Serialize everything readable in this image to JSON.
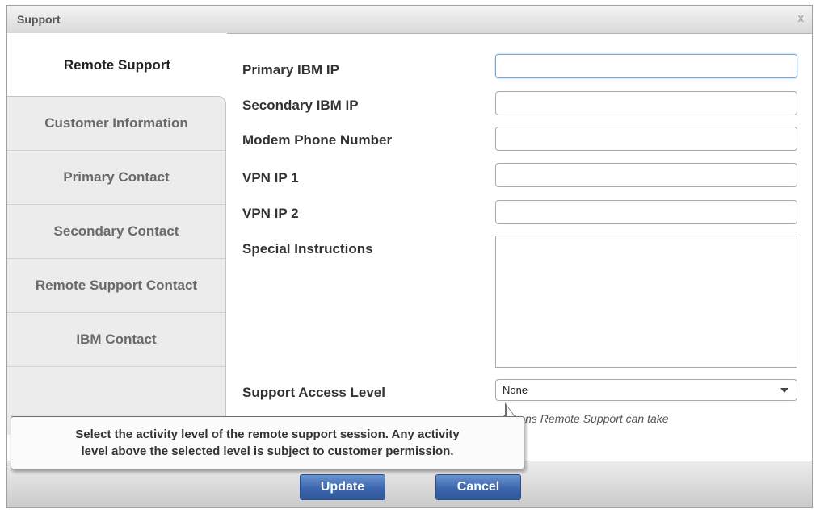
{
  "dialog": {
    "title": "Support",
    "close_label": "x"
  },
  "tabs": {
    "active": "Remote Support",
    "items": [
      {
        "label": "Customer Information"
      },
      {
        "label": "Primary Contact"
      },
      {
        "label": "Secondary Contact"
      },
      {
        "label": "Remote Support Contact"
      },
      {
        "label": "IBM Contact"
      }
    ]
  },
  "form": {
    "primary_ibm_ip": {
      "label": "Primary IBM IP",
      "value": ""
    },
    "secondary_ibm_ip": {
      "label": "Secondary IBM IP",
      "value": ""
    },
    "modem_phone_number": {
      "label": "Modem Phone Number",
      "value": ""
    },
    "vpn_ip_1": {
      "label": "VPN IP 1",
      "value": ""
    },
    "vpn_ip_2": {
      "label": "VPN IP 2",
      "value": ""
    },
    "special_instructions": {
      "label": "Special Instructions",
      "value": ""
    },
    "support_access_level": {
      "label": "Support Access Level",
      "selected": "None",
      "hint": "Actions Remote Support can take"
    }
  },
  "tooltip": {
    "line1": "Select the activity level of the remote support session. Any activity",
    "line2": "level above the selected level is subject to customer permission."
  },
  "buttons": {
    "update": "Update",
    "cancel": "Cancel"
  },
  "icons": {
    "close": "close-icon",
    "dropdown": "chevron-down-icon"
  },
  "colors": {
    "button_blue": "#3b66ad",
    "focus_border": "#7fa6cc"
  }
}
